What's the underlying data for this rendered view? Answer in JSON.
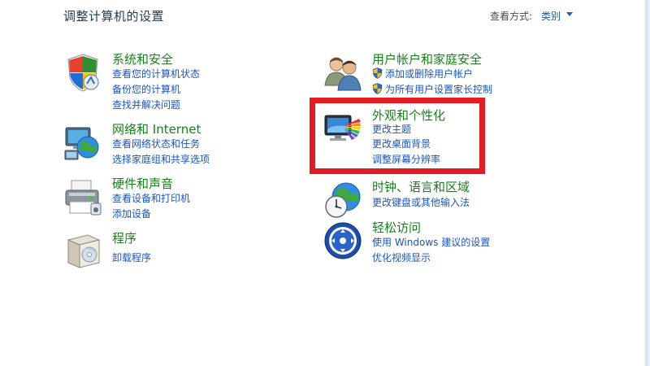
{
  "header": {
    "title": "调整计算机的设置",
    "view_by_label": "查看方式:",
    "view_by_value": "类别"
  },
  "categories": {
    "security": {
      "title": "系统和安全",
      "links": [
        "查看您的计算机状态",
        "备份您的计算机",
        "查找并解决问题"
      ]
    },
    "network": {
      "title": "网络和 Internet",
      "links": [
        "查看网络状态和任务",
        "选择家庭组和共享选项"
      ]
    },
    "hardware": {
      "title": "硬件和声音",
      "links": [
        "查看设备和打印机",
        "添加设备"
      ]
    },
    "programs": {
      "title": "程序",
      "links": [
        "卸载程序"
      ]
    },
    "users": {
      "title": "用户帐户和家庭安全",
      "links": [
        "添加或删除用户帐户",
        "为所有用户设置家长控制"
      ]
    },
    "appearance": {
      "title": "外观和个性化",
      "links": [
        "更改主题",
        "更改桌面背景",
        "调整屏幕分辨率"
      ]
    },
    "clock": {
      "title": "时钟、语言和区域",
      "links": [
        "更改键盘或其他输入法"
      ]
    },
    "ease": {
      "title": "轻松访问",
      "links": [
        "使用 Windows 建议的设置",
        "优化视频显示"
      ]
    }
  },
  "colors": {
    "category_title": "#17811a",
    "link": "#1a55c3",
    "highlight": "#e31b23",
    "page_title": "#1e395b"
  }
}
